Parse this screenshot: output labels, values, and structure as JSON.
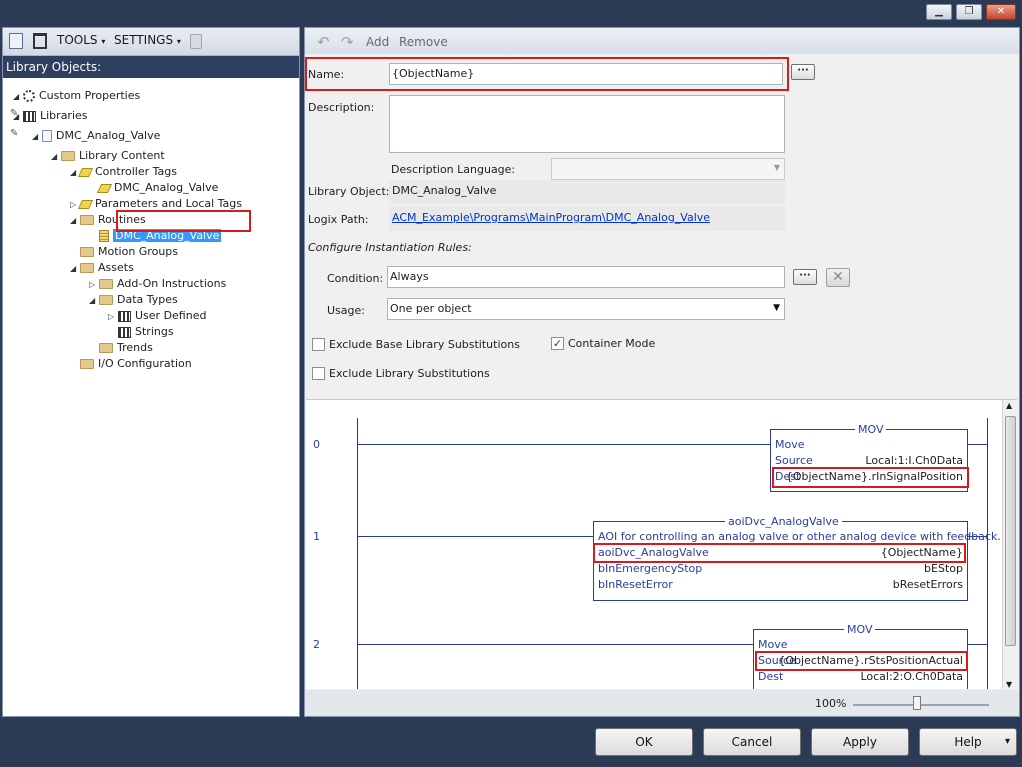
{
  "window": {
    "minimize_glyph": "▁",
    "restore_glyph": "❐",
    "close_glyph": "✕"
  },
  "left": {
    "toolbar": {
      "tools_label": "TOOLS",
      "settings_label": "SETTINGS"
    },
    "header": "Library Objects:",
    "tree": [
      {
        "label": "Custom Properties",
        "icon": "gear-icon"
      },
      {
        "label": "Libraries",
        "icon": "library-icon"
      },
      {
        "label": "DMC_Analog_Valve",
        "icon": "document-icon"
      },
      {
        "label": "Library Content",
        "icon": "folder-icon"
      },
      {
        "label": "Controller Tags",
        "icon": "tag-icon"
      },
      {
        "label": "DMC_Analog_Valve",
        "icon": "tag-icon"
      },
      {
        "label": "Parameters and Local Tags",
        "icon": "tag-icon"
      },
      {
        "label": "Routines",
        "icon": "folder-icon"
      },
      {
        "label": "DMC_Analog_Valve",
        "icon": "routine-icon",
        "selected": true
      },
      {
        "label": "Motion Groups",
        "icon": "folder-icon"
      },
      {
        "label": "Assets",
        "icon": "folder-icon"
      },
      {
        "label": "Add-On Instructions",
        "icon": "folder-icon"
      },
      {
        "label": "Data Types",
        "icon": "folder-icon"
      },
      {
        "label": "User Defined",
        "icon": "datatype-icon"
      },
      {
        "label": "Strings",
        "icon": "datatype-icon"
      },
      {
        "label": "Trends",
        "icon": "folder-icon"
      },
      {
        "label": "I/O Configuration",
        "icon": "folder-icon"
      }
    ]
  },
  "right": {
    "toolbar": {
      "add_label": "Add",
      "remove_label": "Remove"
    },
    "form": {
      "name_label": "Name:",
      "name_value": "{ObjectName}",
      "description_label": "Description:",
      "description_value": "",
      "description_language_label": "Description Language:",
      "description_language_value": "",
      "library_object_label": "Library Object:",
      "library_object_value": "DMC_Analog_Valve",
      "logix_path_label": "Logix Path:",
      "logix_path_value": "ACM_Example\\Programs\\MainProgram\\DMC_Analog_Valve",
      "instantiation_rules_label": "Configure Instantiation Rules:",
      "condition_label": "Condition:",
      "condition_value": "Always",
      "usage_label": "Usage:",
      "usage_value": "One per object",
      "exclude_base_label": "Exclude Base Library Substitutions",
      "exclude_base_checked": false,
      "container_mode_label": "Container Mode",
      "container_mode_checked": true,
      "exclude_library_label": "Exclude Library Substitutions",
      "exclude_library_checked": false,
      "ellipsis_glyph": "···",
      "clear_glyph": "✕",
      "dropdown_glyph": "▼",
      "check_glyph": "✓"
    },
    "ladder": {
      "rungs": [
        {
          "number": "0",
          "title": "MOV",
          "rows": [
            {
              "name": "Move",
              "value": ""
            },
            {
              "name": "Source",
              "value": "Local:1:I.Ch0Data"
            },
            {
              "name": "Dest",
              "value": "{ObjectName}.rInSignalPosition"
            }
          ]
        },
        {
          "number": "1",
          "title": "aoiDvc_AnalogValve",
          "rows": [
            {
              "name": "AOI for controlling an analog valve or other analog device with feedback.",
              "value": ""
            },
            {
              "name": "aoiDvc_AnalogValve",
              "value": "{ObjectName}"
            },
            {
              "name": "bInEmergencyStop",
              "value": "bEStop"
            },
            {
              "name": "bInResetError",
              "value": "bResetErrors"
            }
          ]
        },
        {
          "number": "2",
          "title": "MOV",
          "rows": [
            {
              "name": "Move",
              "value": ""
            },
            {
              "name": "Source",
              "value": "{ObjectName}.rStsPositionActual"
            },
            {
              "name": "Dest",
              "value": "Local:2:O.Ch0Data"
            }
          ]
        }
      ]
    },
    "zoom": {
      "level_percent": 100,
      "label": "100%"
    }
  },
  "buttons": {
    "ok": "OK",
    "cancel": "Cancel",
    "apply": "Apply",
    "help": "Help",
    "help_arrow": "▾"
  },
  "colors": {
    "accent": "#2b3a55",
    "highlight": "#d91a1a",
    "selection": "#3399ff",
    "ladder_blue": "#2a3d9c"
  }
}
